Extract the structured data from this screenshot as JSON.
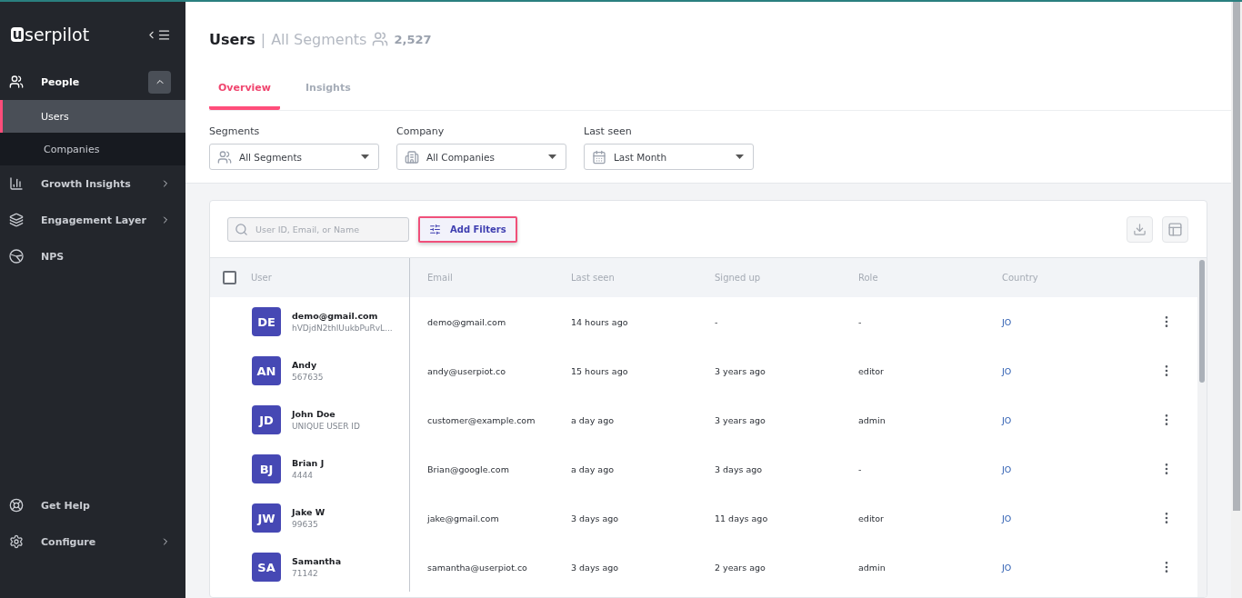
{
  "logo": {
    "mark": "u",
    "text": "serpilot"
  },
  "sidebar": {
    "items": [
      {
        "label": "People",
        "kind": "group",
        "expanded": true,
        "children": [
          {
            "label": "Users",
            "selected": true
          },
          {
            "label": "Companies",
            "selected": false
          }
        ]
      },
      {
        "label": "Growth Insights",
        "kind": "link",
        "expanded": false
      },
      {
        "label": "Engagement Layer",
        "kind": "link",
        "expanded": false
      },
      {
        "label": "NPS",
        "kind": "plain"
      }
    ],
    "bottom": [
      {
        "label": "Get Help",
        "kind": "plain"
      },
      {
        "label": "Configure",
        "kind": "link",
        "expanded": false
      }
    ]
  },
  "header": {
    "title": "Users",
    "separator": "|",
    "segment": "All Segments",
    "count": "2,527"
  },
  "tabs": [
    {
      "label": "Overview",
      "selected": true
    },
    {
      "label": "Insights",
      "selected": false
    }
  ],
  "filters": [
    {
      "label": "Segments",
      "value": "All Segments"
    },
    {
      "label": "Company",
      "value": "All Companies"
    },
    {
      "label": "Last seen",
      "value": "Last Month"
    }
  ],
  "search": {
    "placeholder": "User ID, Email, or Name"
  },
  "add_filters": "Add Filters",
  "table": {
    "select_all_checked": false,
    "columns": [
      "User",
      "Email",
      "Last seen",
      "Signed up",
      "Role",
      "Country"
    ],
    "rows": [
      {
        "initials": "DE",
        "name": "demo@gmail.com",
        "id": "hVDjdN2thIUukbPuRvL...",
        "email": "demo@gmail.com",
        "last_seen": "14 hours ago",
        "signed_up": "-",
        "role": "-",
        "country": "JO"
      },
      {
        "initials": "AN",
        "name": "Andy",
        "id": "567635",
        "email": "andy@userpiot.co",
        "last_seen": "15 hours ago",
        "signed_up": "3 years ago",
        "role": "editor",
        "country": "JO"
      },
      {
        "initials": "JD",
        "name": "John Doe",
        "id": "UNIQUE USER ID",
        "email": "customer@example.com",
        "last_seen": "a day ago",
        "signed_up": "3 years ago",
        "role": "admin",
        "country": "JO"
      },
      {
        "initials": "BJ",
        "name": "Brian J",
        "id": "4444",
        "email": "Brian@google.com",
        "last_seen": "a day ago",
        "signed_up": "3 days ago",
        "role": "-",
        "country": "JO"
      },
      {
        "initials": "JW",
        "name": "Jake W",
        "id": "99635",
        "email": "jake@gmail.com",
        "last_seen": "3 days ago",
        "signed_up": "11 days ago",
        "role": "editor",
        "country": "JO"
      },
      {
        "initials": "SA",
        "name": "Samantha",
        "id": "71142",
        "email": "samantha@userpiot.co",
        "last_seen": "3 days ago",
        "signed_up": "2 years ago",
        "role": "admin",
        "country": "JO"
      }
    ]
  }
}
